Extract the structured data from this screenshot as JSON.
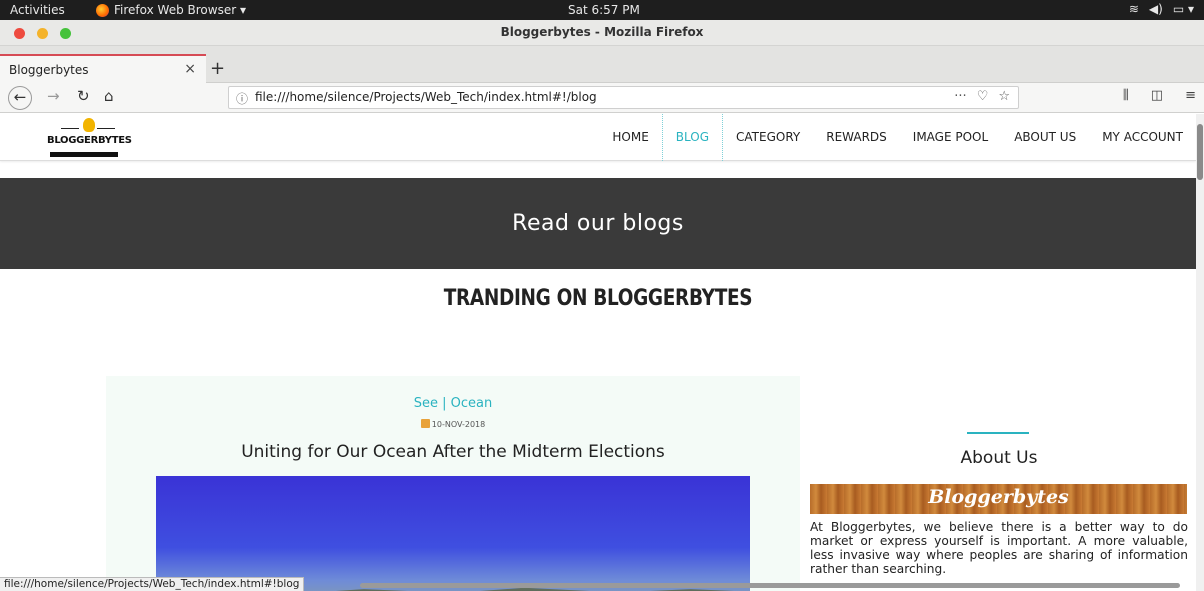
{
  "system_bar": {
    "activities": "Activities",
    "app_name": "Firefox Web Browser ▾",
    "clock": "Sat  6:57 PM"
  },
  "window": {
    "title": "Bloggerbytes - Mozilla Firefox"
  },
  "tabs": [
    {
      "label": "Bloggerbytes"
    }
  ],
  "toolbar": {
    "url": "file:///home/silence/Projects/Web_Tech/index.html#!/blog"
  },
  "site": {
    "logo_text": "BLOGGERBYTES",
    "menu": [
      "HOME",
      "BLOG",
      "CATEGORY",
      "REWARDS",
      "IMAGE POOL",
      "ABOUT US",
      "MY ACCOUNT"
    ],
    "active_menu": "BLOG",
    "banner_title": "Read our blogs",
    "section_title": "TRANDING ON BLOGGERBYTES",
    "post": {
      "category": "See | Ocean",
      "date": "10-NOV-2018",
      "title": "Uniting for Our Ocean After the Midterm Elections"
    },
    "sidebar": {
      "title": "About Us",
      "banner_text": "Bloggerbytes",
      "text": "At Bloggerbytes, we believe there is a better way to do market or express yourself is important. A more valuable, less invasive way where peoples are sharing of information rather than searching."
    }
  },
  "status": {
    "link": "file:///home/silence/Projects/Web_Tech/index.html#!blog"
  },
  "colors": {
    "accent": "#2ab3c0",
    "banner_bg": "#3a3a3a",
    "tab_accent": "#d64b55"
  }
}
